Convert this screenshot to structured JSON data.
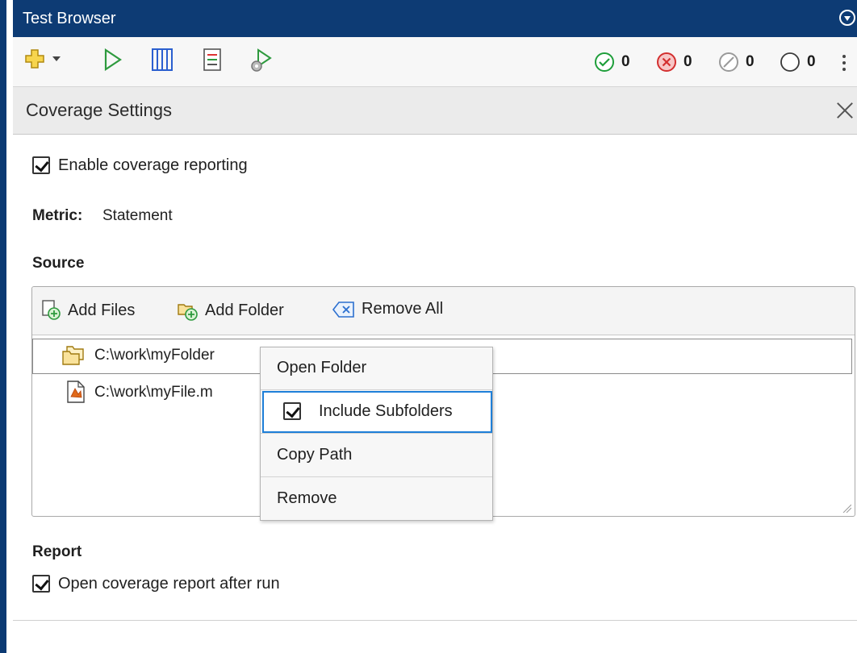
{
  "window": {
    "title": "Test Browser"
  },
  "toolbar": {
    "status_counts": [
      {
        "name": "passed",
        "value": "0",
        "color": "#1e9e3a"
      },
      {
        "name": "failed",
        "value": "0",
        "color": "#d32f2f"
      },
      {
        "name": "incomplete",
        "value": "0",
        "color": "#9a9a9a"
      },
      {
        "name": "not-run",
        "value": "0",
        "color": "#3a3a3a"
      }
    ]
  },
  "panel": {
    "title": "Coverage Settings",
    "enable_coverage_label": "Enable coverage reporting",
    "metric_label": "Metric:",
    "metric_value": "Statement",
    "source_heading": "Source",
    "source_toolbar": {
      "add_files": "Add Files",
      "add_folder": "Add Folder",
      "remove_all": "Remove All"
    },
    "source_items": [
      {
        "path": "C:\\work\\myFolder",
        "type": "folder"
      },
      {
        "path": "C:\\work\\myFile.m",
        "type": "file"
      }
    ],
    "report_heading": "Report",
    "open_report_label": "Open coverage report after run"
  },
  "context_menu": {
    "items": [
      {
        "label": "Open Folder"
      },
      {
        "label": "Include Subfolders",
        "checked": true
      },
      {
        "label": "Copy Path"
      },
      {
        "label": "Remove"
      }
    ]
  }
}
